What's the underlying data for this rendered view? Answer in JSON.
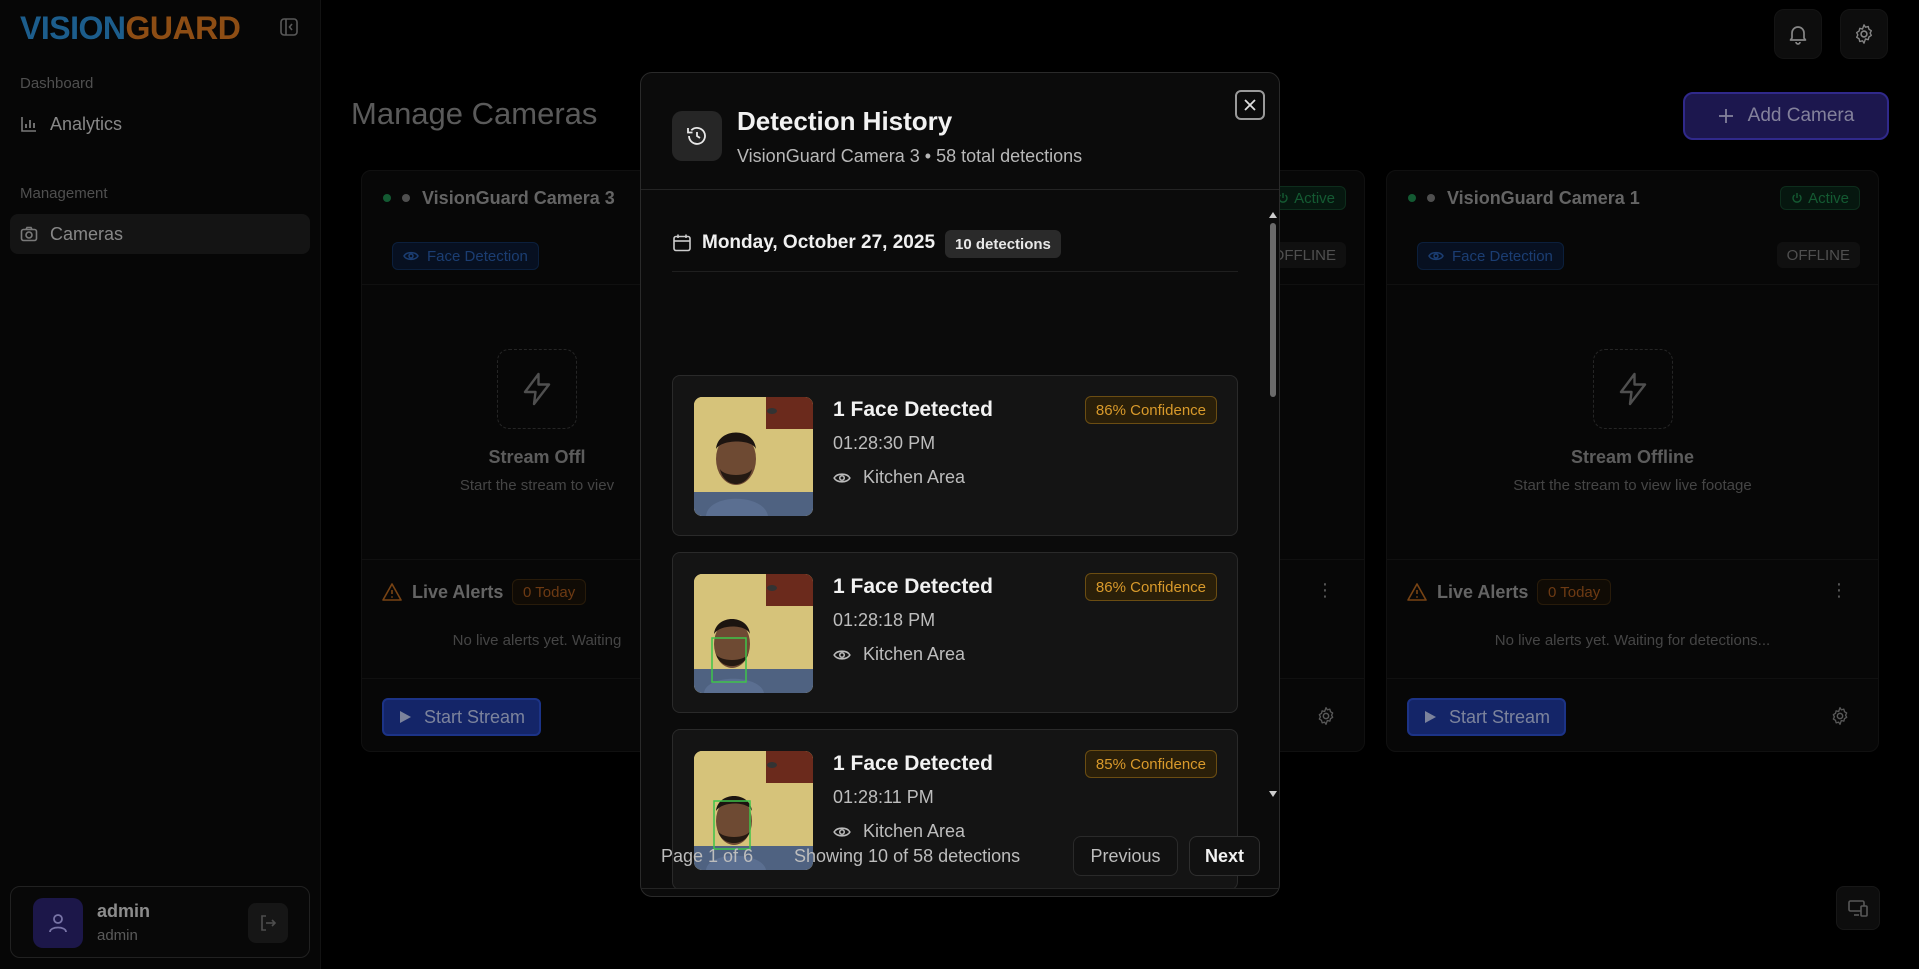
{
  "brand": {
    "part1": "VISION",
    "part2": "GUARD"
  },
  "sidebar": {
    "sections": [
      {
        "label": "Dashboard",
        "items": [
          {
            "label": "Analytics",
            "icon": "bar-chart-icon"
          }
        ]
      },
      {
        "label": "Management",
        "items": [
          {
            "label": "Cameras",
            "icon": "camera-icon",
            "active": true
          }
        ]
      }
    ],
    "user": {
      "name": "admin",
      "role": "admin"
    }
  },
  "page": {
    "title": "Manage Cameras",
    "add_camera_label": "Add Camera"
  },
  "cameras": [
    {
      "name": "VisionGuard Camera 3",
      "feature": "Face Detection",
      "stream_title": "Stream Offl",
      "stream_sub": "Start the stream to viev",
      "alerts_label": "Live Alerts",
      "alerts_count": "0 Today",
      "alerts_empty": "No live alerts yet. Waiting",
      "start_label": "Start Stream"
    },
    {
      "status": "Active",
      "offline": "OFFLINE"
    },
    {
      "name": "VisionGuard Camera 1",
      "status": "Active",
      "feature": "Face Detection",
      "offline": "OFFLINE",
      "stream_title": "Stream Offline",
      "stream_sub": "Start the stream to view live footage",
      "alerts_label": "Live Alerts",
      "alerts_count": "0 Today",
      "alerts_empty": "No live alerts yet. Waiting for detections...",
      "start_label": "Start Stream"
    }
  ],
  "modal": {
    "title": "Detection History",
    "subtitle": "VisionGuard Camera 3 • 58 total detections",
    "date_label": "Monday, October 27, 2025",
    "date_count": "10 detections",
    "detections": [
      {
        "title": "1 Face Detected",
        "time": "01:28:30 PM",
        "location": "Kitchen Area",
        "confidence": "86% Confidence"
      },
      {
        "title": "1 Face Detected",
        "time": "01:28:18 PM",
        "location": "Kitchen Area",
        "confidence": "86% Confidence"
      },
      {
        "title": "1 Face Detected",
        "time": "01:28:11 PM",
        "location": "Kitchen Area",
        "confidence": "85% Confidence"
      }
    ],
    "footer": {
      "page_info": "Page 1 of 6",
      "showing": "Showing 10 of 58 detections",
      "prev_label": "Previous",
      "next_label": "Next"
    }
  },
  "colors": {
    "brand_blue": "#2b8fd8",
    "brand_orange": "#d9771f",
    "accent": "#4a3fd6",
    "confidence": "#d99a2b"
  }
}
